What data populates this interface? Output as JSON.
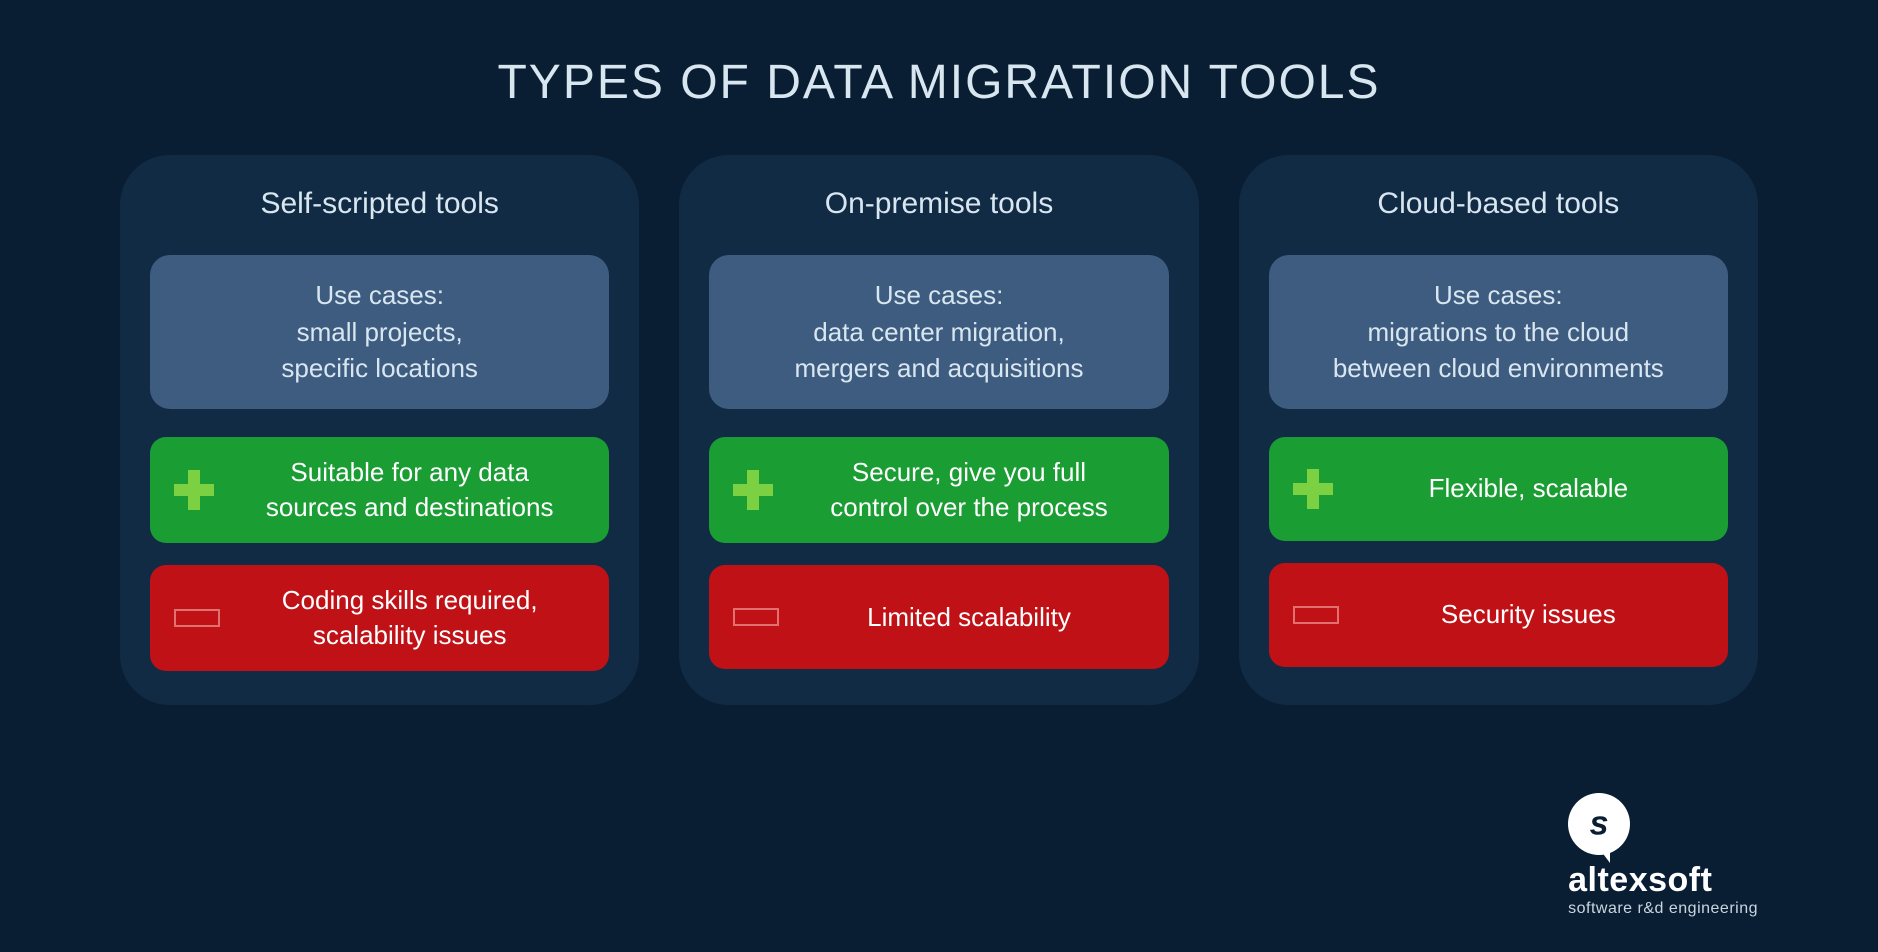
{
  "title": "TYPES OF DATA MIGRATION TOOLS",
  "cards": [
    {
      "title": "Self-scripted tools",
      "usecase": "Use cases:\nsmall projects,\nspecific locations",
      "pro": "Suitable for any data\nsources and destinations",
      "con": "Coding skills required,\nscalability issues"
    },
    {
      "title": "On-premise tools",
      "usecase": "Use cases:\ndata center migration,\nmergers and acquisitions",
      "pro": "Secure, give you full\ncontrol over the process",
      "con": "Limited scalability"
    },
    {
      "title": "Cloud-based tools",
      "usecase": "Use cases:\nmigrations to the cloud\nbetween cloud environments",
      "pro": "Flexible, scalable",
      "con": "Security issues"
    }
  ],
  "logo": {
    "name": "altexsoft",
    "tagline": "software r&d engineering"
  }
}
